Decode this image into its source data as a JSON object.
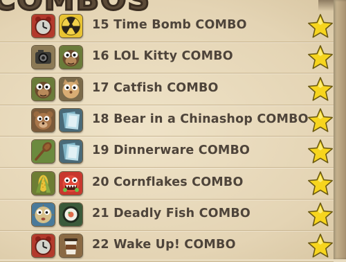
{
  "header": {
    "title": "COMBOS"
  },
  "combos": [
    {
      "number": "15",
      "name": "Time Bomb COMBO",
      "icons": [
        "alarm-clock-icon",
        "radioactive-icon"
      ]
    },
    {
      "number": "16",
      "name": "LOL Kitty COMBO",
      "icons": [
        "camera-icon",
        "monkey-face-icon"
      ]
    },
    {
      "number": "17",
      "name": "Catfish COMBO",
      "icons": [
        "monkey-face-icon",
        "cat-face-icon"
      ]
    },
    {
      "number": "18",
      "name": "Bear in a Chinashop COMBO",
      "icons": [
        "bear-face-icon",
        "china-plate-icon"
      ]
    },
    {
      "number": "19",
      "name": "Dinnerware COMBO",
      "icons": [
        "wooden-spoon-icon",
        "china-plate-icon"
      ]
    },
    {
      "number": "20",
      "name": "Cornflakes COMBO",
      "icons": [
        "corn-icon",
        "monster-face-icon"
      ]
    },
    {
      "number": "21",
      "name": "Deadly Fish COMBO",
      "icons": [
        "pufferfish-icon",
        "sushi-roll-icon"
      ]
    },
    {
      "number": "22",
      "name": "Wake Up! COMBO",
      "icons": [
        "alarm-clock-icon",
        "coffee-cup-icon"
      ]
    }
  ],
  "colors": {
    "star": "#f7d51e",
    "text": "#4e443a",
    "paper": "#e9dcc0"
  }
}
